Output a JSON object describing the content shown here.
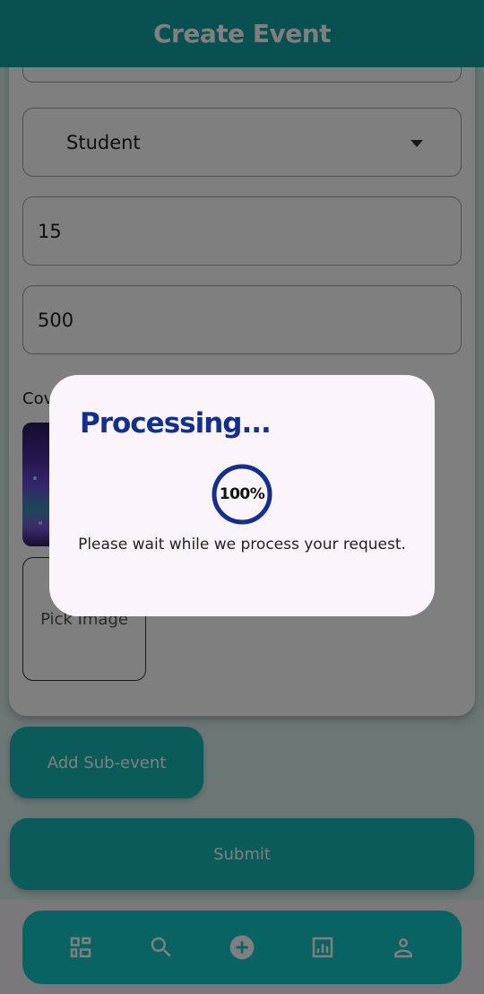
{
  "app_bar": {
    "title": "Create Event"
  },
  "form": {
    "category_value": "Student",
    "field_1_value": "15",
    "field_2_value": "500",
    "cover_label": "Cove",
    "pick_image_label": "Pick Image"
  },
  "buttons": {
    "add_sub_event": "Add Sub-event",
    "submit": "Submit"
  },
  "bottom_nav": {
    "icons": [
      "dashboard-icon",
      "search-icon",
      "add-circle-icon",
      "analytics-icon",
      "person-icon"
    ]
  },
  "dialog": {
    "title": "Processing...",
    "progress_text": "100%",
    "progress_value": 1.0,
    "message": "Please wait while we process your request."
  },
  "colors": {
    "primary": "#13a3a3",
    "nav": "#14c6c6",
    "dialog_title": "#14308f",
    "progress_ring": "#14308f"
  }
}
